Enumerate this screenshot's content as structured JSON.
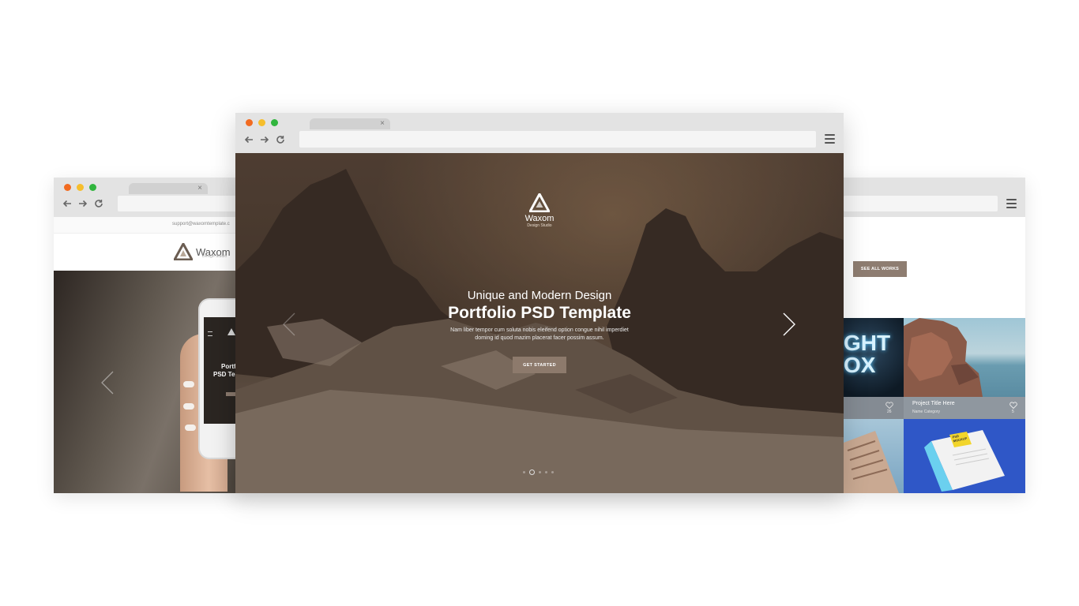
{
  "left_window": {
    "support_email": "support@waxomtemplate.c",
    "logo_text": "Waxom",
    "logo_sub": "Design Studio",
    "phone_title_1": "Portf",
    "phone_title_2": "PSD Tem"
  },
  "front_window": {
    "logo_text": "Waxom",
    "logo_sub": "Design Studio",
    "hero_kicker": "Unique and Modern Design",
    "hero_title": "Portfolio PSD Template",
    "hero_desc": "Nam liber tempor cum soluta nobis eleifend option congue nihil imperdiet doming id quod mazim placerat facer possim assum.",
    "cta_label": "GET STARTED",
    "slides": 5,
    "active_slide": 2
  },
  "right_window": {
    "button_label": "SEE ALL WORKS",
    "tile_text": "GHT OX",
    "project_title": "Project Title Here",
    "project_category": "Name Category",
    "like_count_1": "26",
    "like_count_2": "5",
    "paper_label": "PSD MOCKUP"
  },
  "colors": {
    "chrome": "#e3e3e3",
    "accent_button": "#8d7a6c",
    "dot_red": "#f26b21",
    "dot_yellow": "#f6be2c",
    "dot_green": "#31b53e"
  }
}
